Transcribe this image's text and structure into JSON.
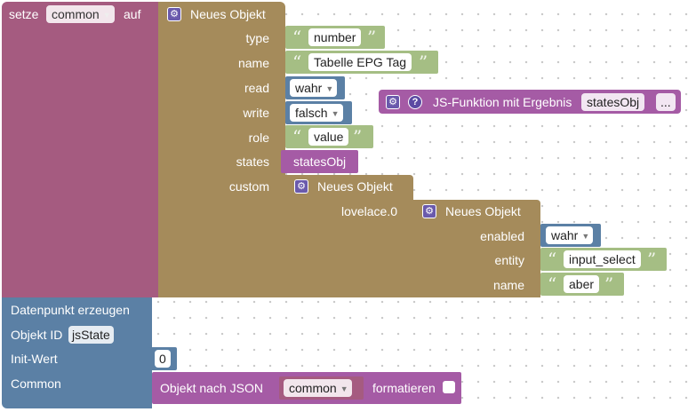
{
  "colors": {
    "setze": "#a55b80",
    "object": "#a58b5b",
    "text": "#a5be84",
    "logic": "#5b80a5",
    "function": "#a55ba5",
    "create": "#5b80a5",
    "math": "#5b80a5"
  },
  "setze": {
    "label": "setze",
    "var": "common",
    "suffix": "auf"
  },
  "obj1": {
    "title": "Neues Objekt"
  },
  "fields": {
    "type": {
      "label": "type",
      "value": "number"
    },
    "name": {
      "label": "name",
      "value": "Tabelle EPG Tag"
    },
    "read": {
      "label": "read",
      "value": "wahr"
    },
    "write": {
      "label": "write",
      "value": "falsch"
    },
    "role": {
      "label": "role",
      "value": "value"
    },
    "states": {
      "label": "states",
      "value": "statesObj"
    },
    "custom": {
      "label": "custom"
    }
  },
  "obj2": {
    "title": "Neues Objekt",
    "key": "lovelace.0"
  },
  "obj3": {
    "title": "Neues Objekt",
    "enabled_label": "enabled",
    "enabled_value": "wahr",
    "entity_label": "entity",
    "entity_value": "input_select",
    "name_label": "name",
    "name_value": "aber"
  },
  "jsfunc": {
    "label": "JS-Funktion mit Ergebnis",
    "var": "statesObj",
    "more": "..."
  },
  "create": {
    "title": "Datenpunkt erzeugen",
    "id_label": "Objekt ID",
    "id_value": "jsState",
    "init_label": "Init-Wert",
    "init_value": "0",
    "common_label": "Common"
  },
  "json": {
    "label": "Objekt nach JSON",
    "var": "common",
    "suffix": "formatieren"
  }
}
